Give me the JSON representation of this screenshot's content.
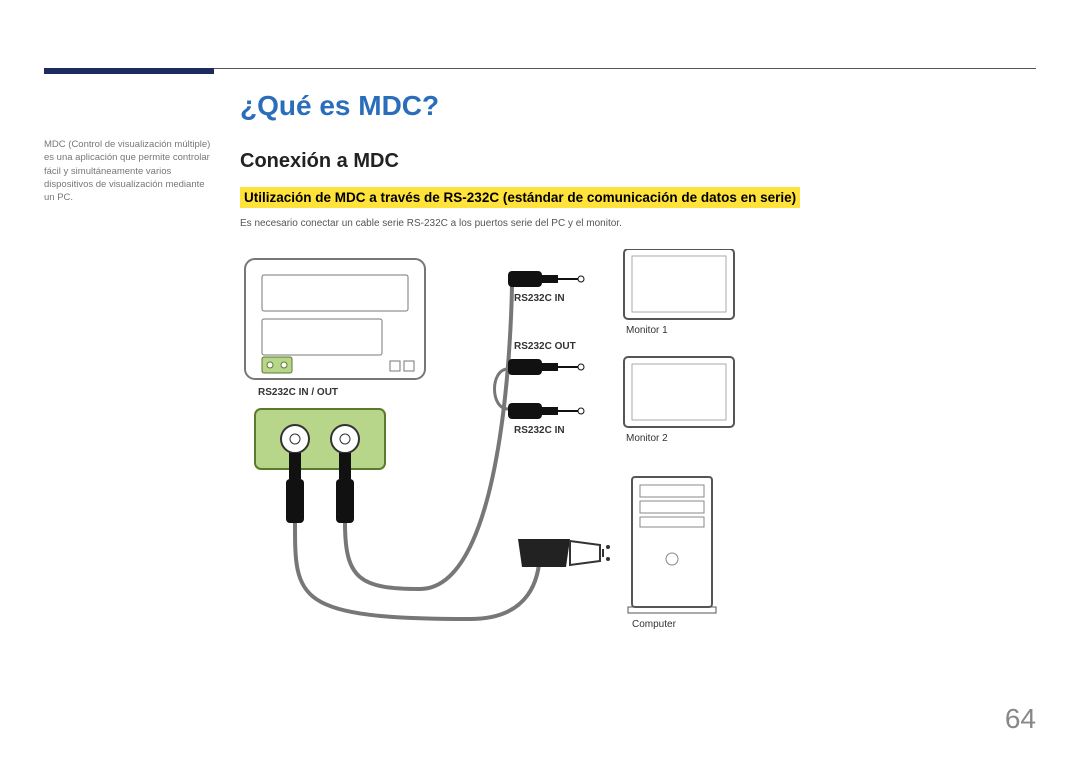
{
  "sideNote": "MDC (Control de visualización múltiple) es una aplicación que permite controlar fácil y simultáneamente varios dispositivos de visualización mediante un PC.",
  "h1": "¿Qué es MDC?",
  "h2": "Conexión a MDC",
  "h3": "Utilización de MDC a través de RS-232C (estándar de comunicación de datos en serie)",
  "body": "Es necesario conectar un cable serie RS-232C a los puertos serie del PC y el monitor.",
  "labels": {
    "inout": "RS232C IN / OUT",
    "in1": "RS232C IN",
    "out": "RS232C OUT",
    "in2": "RS232C IN",
    "mon1": "Monitor 1",
    "mon2": "Monitor 2",
    "computer": "Computer"
  },
  "pageNumber": "64"
}
